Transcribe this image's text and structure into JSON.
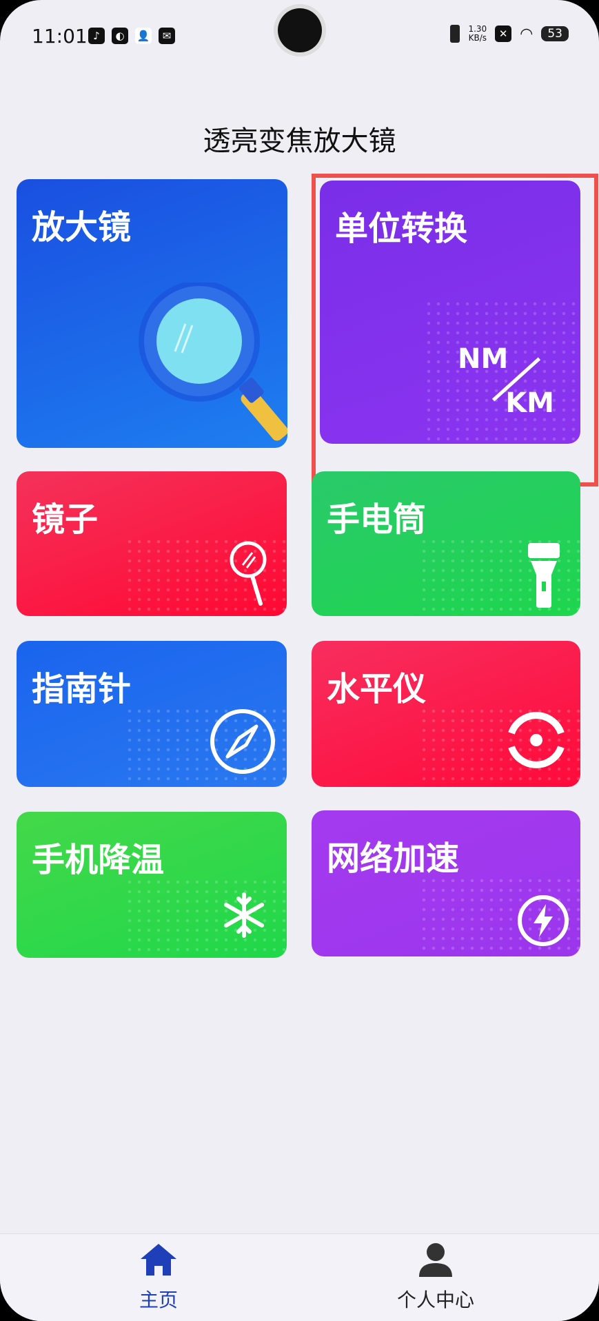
{
  "status_bar": {
    "time": "11:01",
    "network_speed_value": "1.30",
    "network_speed_unit": "KB/s",
    "battery": "53"
  },
  "page_title": "透亮变焦放大镜",
  "tiles": [
    {
      "label": "放大镜",
      "icon": "magnifier-icon"
    },
    {
      "label": "单位转换",
      "icon": "unit-convert-icon",
      "icon_top": "NM",
      "icon_bottom": "KM"
    },
    {
      "label": "镜子",
      "icon": "mirror-icon"
    },
    {
      "label": "手电筒",
      "icon": "flashlight-icon"
    },
    {
      "label": "指南针",
      "icon": "compass-icon"
    },
    {
      "label": "水平仪",
      "icon": "level-icon"
    },
    {
      "label": "手机降温",
      "icon": "snowflake-icon"
    },
    {
      "label": "网络加速",
      "icon": "lightning-icon"
    }
  ],
  "bottom_nav": [
    {
      "label": "主页",
      "icon": "home-icon",
      "active": true
    },
    {
      "label": "个人中心",
      "icon": "person-icon",
      "active": false
    }
  ],
  "colors": {
    "highlight": "#f0504c",
    "nav_active": "#1f3fb8"
  }
}
